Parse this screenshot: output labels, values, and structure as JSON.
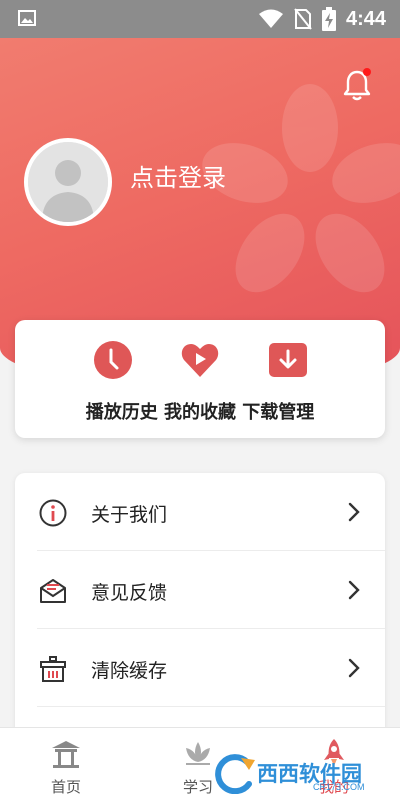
{
  "status_bar": {
    "time": "4:44",
    "icons": [
      "image-icon",
      "wifi-icon",
      "no-sim-icon",
      "battery-charging-icon"
    ]
  },
  "header": {
    "login_text": "点击登录",
    "bell_icon": "bell-icon",
    "bell_has_notification": true
  },
  "quick_actions": {
    "labels_line": "播放历史 我的收藏 下载管理",
    "items": [
      {
        "name": "播放历史",
        "icon": "clock-icon"
      },
      {
        "name": "我的收藏",
        "icon": "heart-play-icon"
      },
      {
        "name": "下载管理",
        "icon": "download-icon"
      }
    ]
  },
  "menu": {
    "items": [
      {
        "label": "关于我们",
        "icon": "info-icon"
      },
      {
        "label": "意见反馈",
        "icon": "feedback-mail-icon"
      },
      {
        "label": "清除缓存",
        "icon": "trash-basket-icon"
      }
    ]
  },
  "bottom_nav": {
    "items": [
      {
        "label": "首页",
        "icon": "home-pavilion-icon",
        "active": false
      },
      {
        "label": "学习",
        "icon": "lotus-icon",
        "active": false
      },
      {
        "label": "我的",
        "icon": "rocket-icon",
        "active": true
      }
    ]
  },
  "watermark": {
    "text": "西西软件园",
    "sub": "CR173.COM"
  },
  "colors": {
    "accent": "#e04a50",
    "header_gradient_start": "#f17c6f",
    "header_gradient_end": "#e4525a",
    "status_bar": "#8c8c8c"
  }
}
